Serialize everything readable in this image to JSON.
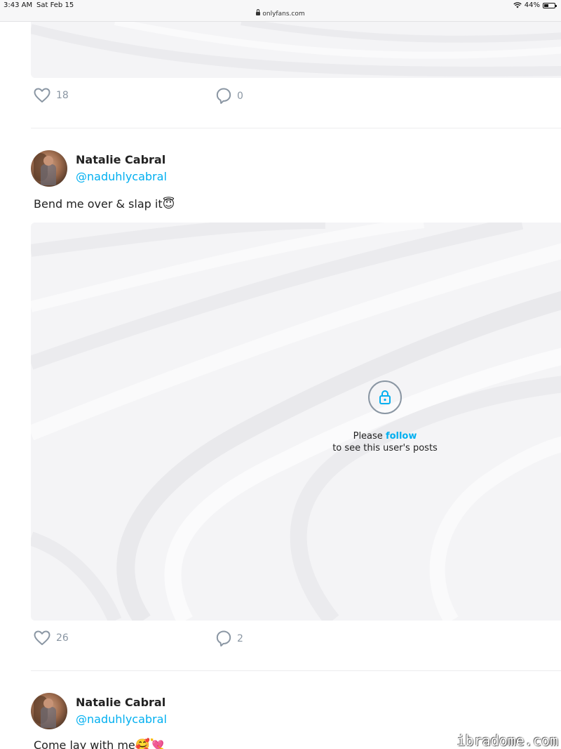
{
  "status_bar": {
    "time": "3:43 AM",
    "date": "Sat Feb 15",
    "url": "onlyfans.com",
    "battery": "44%",
    "battery_level": 0.44
  },
  "posts": [
    {
      "likes": "18",
      "comments": "0"
    },
    {
      "display_name": "Natalie Cabral",
      "username": "@naduhlycabral",
      "text": "Bend me over & slap it",
      "emoji": "😇",
      "locked": {
        "prompt_prefix": "Please ",
        "follow_link": "follow",
        "prompt_suffix": "to see this user's posts"
      },
      "likes": "26",
      "comments": "2"
    },
    {
      "display_name": "Natalie Cabral",
      "username": "@naduhlycabral",
      "text": "Come lay with me",
      "emoji": "🥰💘"
    }
  ],
  "icons": {
    "like": "heart-icon",
    "comment": "comment-bubble-icon",
    "locked": "lock-icon"
  },
  "colors": {
    "accent": "#00aff0",
    "muted": "#8a96a3"
  },
  "watermark": "ibradome.com"
}
